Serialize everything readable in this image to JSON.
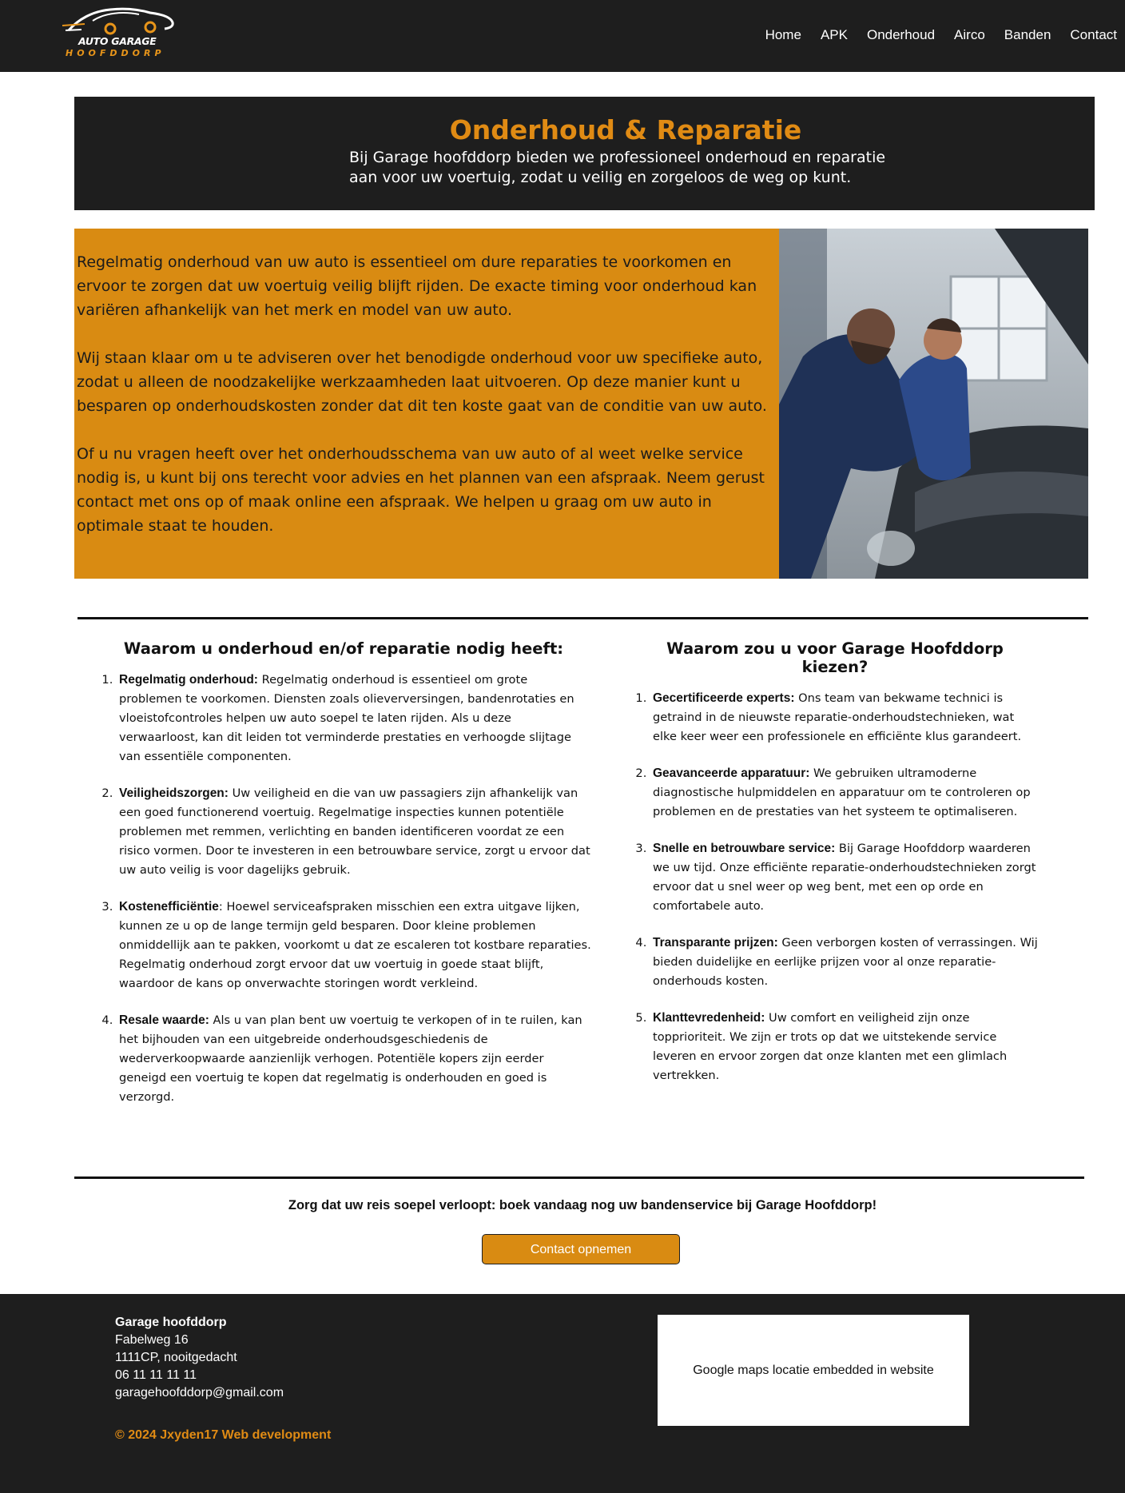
{
  "header": {
    "logo": {
      "line1": "AUTO GARAGE",
      "line2": "HOOFDDORP"
    },
    "nav": [
      "Home",
      "APK",
      "Onderhoud",
      "Airco",
      "Banden",
      "Contact"
    ]
  },
  "hero": {
    "title": "Onderhoud & Reparatie",
    "text_line1": "Bij Garage hoofddorp bieden we professioneel onderhoud en reparatie",
    "text_line2": "aan voor  uw voertuig, zodat u veilig en zorgeloos de weg op kunt."
  },
  "intro": {
    "paragraphs": [
      "Regelmatig onderhoud van uw auto is  essentieel om dure reparaties te voorkomen en ervoor te zorgen dat uw  voertuig veilig blijft rijden. De exacte timing voor onderhoud kan variëren afhankelijk van het merk en model van uw auto.",
      "Wij staan klaar om u te adviseren  over het benodigde onderhoud voor uw specifieke auto, zodat u alleen de  noodzakelijke werkzaamheden laat uitvoeren. Op deze manier kunt u besparen op onderhoudskosten zonder dat dit ten koste gaat van de  conditie van uw auto.",
      "Of u nu vragen heeft over het  onderhoudsschema van uw auto of al weet welke service nodig is, u kunt  bij ons terecht voor advies en het plannen van een afspraak. Neem gerust contact met ons op of maak online een afspraak. We helpen u graag om uw auto in optimale staat te houden."
    ]
  },
  "left_column": {
    "title": "Waarom u onderhoud en/of reparatie nodig heeft:",
    "items": [
      {
        "label": "Regelmatig onderhoud:",
        "text": " Regelmatig onderhoud is essentieel om grote problemen te voorkomen.  Diensten zoals olieverversingen, bandenrotaties en vloeistofcontroles  helpen uw auto soepel te laten rijden. Als u deze verwaarloost, kan dit  leiden tot verminderde prestaties en verhoogde slijtage van essentiële  componenten."
      },
      {
        "label": "Veiligheidszorgen:",
        "text": " Uw veiligheid en die van uw passagiers zijn afhankelijk van een goed  functionerend voertuig. Regelmatige inspecties kunnen potentiële  problemen met remmen, verlichting en banden identificeren voordat ze een risico vormen. Door te investeren in een betrouwbare service, zorgt u  ervoor dat uw auto veilig is voor dagelijks gebruik."
      },
      {
        "label": "Kostenefficiëntie",
        "text": ": Hoewel serviceafspraken misschien een extra uitgave lijken, kunnen ze u  op de lange termijn geld besparen. Door kleine problemen onmiddellijk  aan te pakken, voorkomt u dat ze escaleren tot kostbare reparaties.  Regelmatig onderhoud zorgt ervoor dat uw voertuig in goede staat blijft, waardoor de kans op onverwachte storingen wordt verkleind."
      },
      {
        "label": "Resale waarde:",
        "text": " Als u van plan bent uw voertuig te verkopen of in te ruilen, kan het  bijhouden van een uitgebreide onderhoudsgeschiedenis de wederverkoopwaarde aanzienlijk verhogen. Potentiële kopers zijn eerder geneigd een voertuig te kopen dat regelmatig is onderhouden en goed is verzorgd."
      }
    ]
  },
  "right_column": {
    "title": "Waarom zou u voor Garage Hoofddorp kiezen?",
    "items": [
      {
        "label": "Gecertificeerde experts:",
        "text": " Ons team van bekwame technici is getraind in de nieuwste reparatie-onderhoudstechnieken, wat elke keer weer een professionele en efficiënte klus garandeert."
      },
      {
        "label": "Geavanceerde apparatuur:",
        "text": " We gebruiken ultramoderne diagnostische hulpmiddelen en apparatuur om te controleren op problemen en de prestaties van het systeem te optimaliseren."
      },
      {
        "label": "Snelle en betrouwbare service:",
        "text": " Bij Garage Hoofddorp waarderen we uw tijd. Onze efficiënte reparatie-onderhoudstechnieken zorgt ervoor dat u snel weer op weg bent, met een op orde en comfortabele auto."
      },
      {
        "label": "Transparante prijzen:",
        "text": " Geen verborgen kosten of verrassingen. Wij bieden duidelijke en eerlijke prijzen voor al onze reparatie-onderhouds kosten."
      },
      {
        "label": "Klanttevredenheid:",
        "text": " Uw comfort en veiligheid zijn onze topprioriteit. We zijn er trots op dat we uitstekende service leveren en ervoor zorgen dat onze klanten met een glimlach vertrekken."
      }
    ]
  },
  "cta": {
    "text": "Zorg dat uw reis soepel verloopt: boek vandaag nog uw bandenservice bij Garage Hoofddorp!",
    "button": "Contact opnemen"
  },
  "footer": {
    "name": "Garage hoofddorp",
    "street": "Fabelweg 16",
    "city": "1111CP, nooitgedacht",
    "phone": "06 11 11 11 11",
    "email": "garagehoofddorp@gmail.com",
    "copyright": "© 2024 Jxyden17 Web development",
    "map_placeholder": "Google maps locatie embedded in website"
  },
  "colors": {
    "dark": "#1e1e1e",
    "accent": "#d98b12",
    "accent_text": "#e08b14"
  }
}
